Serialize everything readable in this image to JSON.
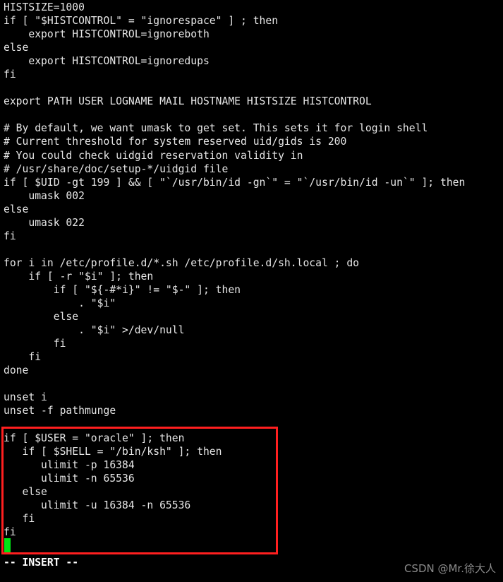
{
  "terminal": {
    "background_color": "#000000",
    "foreground_color": "#e6e6e6",
    "highlight_color": "#ff1f1f",
    "cursor_color": "#00e515",
    "lines": [
      "HISTSIZE=1000",
      "if [ \"$HISTCONTROL\" = \"ignorespace\" ] ; then",
      "    export HISTCONTROL=ignoreboth",
      "else",
      "    export HISTCONTROL=ignoredups",
      "fi",
      "",
      "export PATH USER LOGNAME MAIL HOSTNAME HISTSIZE HISTCONTROL",
      "",
      "# By default, we want umask to get set. This sets it for login shell",
      "# Current threshold for system reserved uid/gids is 200",
      "# You could check uidgid reservation validity in",
      "# /usr/share/doc/setup-*/uidgid file",
      "if [ $UID -gt 199 ] && [ \"`/usr/bin/id -gn`\" = \"`/usr/bin/id -un`\" ]; then",
      "    umask 002",
      "else",
      "    umask 022",
      "fi",
      "",
      "for i in /etc/profile.d/*.sh /etc/profile.d/sh.local ; do",
      "    if [ -r \"$i\" ]; then",
      "        if [ \"${-#*i}\" != \"$-\" ]; then",
      "            . \"$i\"",
      "        else",
      "            . \"$i\" >/dev/null",
      "        fi",
      "    fi",
      "done",
      "",
      "unset i",
      "unset -f pathmunge",
      "",
      "if [ $USER = \"oracle\" ]; then",
      "   if [ $SHELL = \"/bin/ksh\" ]; then",
      "      ulimit -p 16384",
      "      ulimit -n 65536",
      "   else",
      "      ulimit -u 16384 -n 65536",
      "   fi",
      "fi",
      ""
    ]
  },
  "status": {
    "mode_label": "-- INSERT --"
  },
  "watermark": {
    "text": "CSDN @Mr.徐大人"
  }
}
